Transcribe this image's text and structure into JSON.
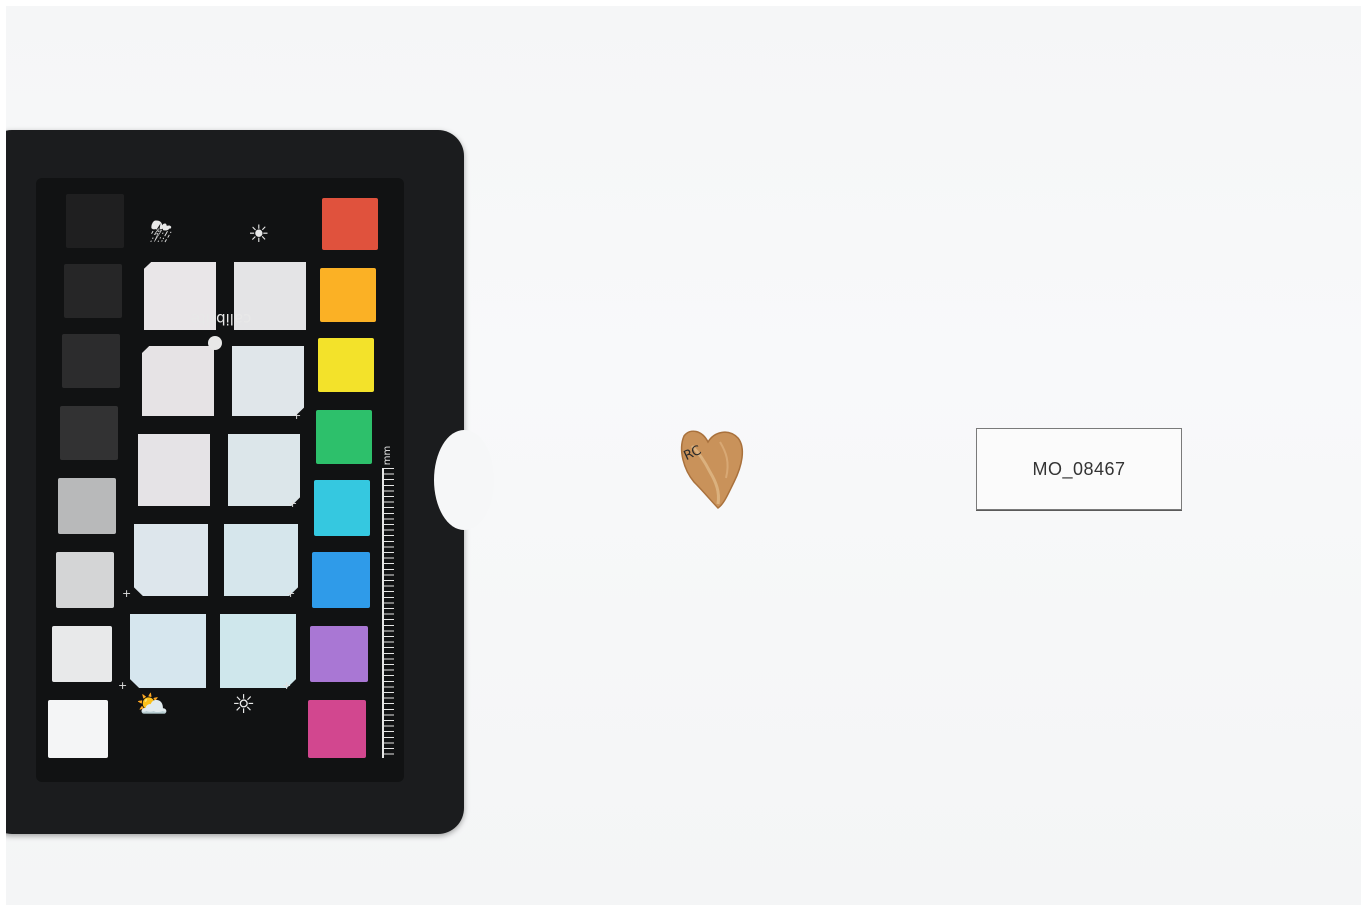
{
  "photo": {
    "background": "#f6f7f8"
  },
  "color_checker": {
    "brand": "calibrite",
    "ruler_unit": "mm",
    "color_swatches": [
      "#e0523d",
      "#fbb125",
      "#f3e22a",
      "#2dc06b",
      "#35c8e0",
      "#2f9be9",
      "#a977d4",
      "#d2478f"
    ],
    "gray_swatches": [
      "#1f1f20",
      "#262627",
      "#2c2c2d",
      "#323233",
      "#b8b9ba",
      "#d4d5d6",
      "#e8e9ea",
      "#f4f5f6"
    ],
    "white_patches": [
      "#e9e6e8",
      "#e4e4e6",
      "#e6e3e5",
      "#e0e6ea",
      "#e5e3e6",
      "#dce6ea",
      "#dde6ec",
      "#d6e6ec",
      "#d6e6ee",
      "#cfe7ec"
    ],
    "icons": [
      "cloud-snow-icon",
      "camera-sun-icon",
      "cloud-sun-icon",
      "camera-flash-icon"
    ]
  },
  "specimen": {
    "ink_mark": "RC",
    "color": "#c9925a"
  },
  "label": {
    "text": "MO_08467"
  }
}
